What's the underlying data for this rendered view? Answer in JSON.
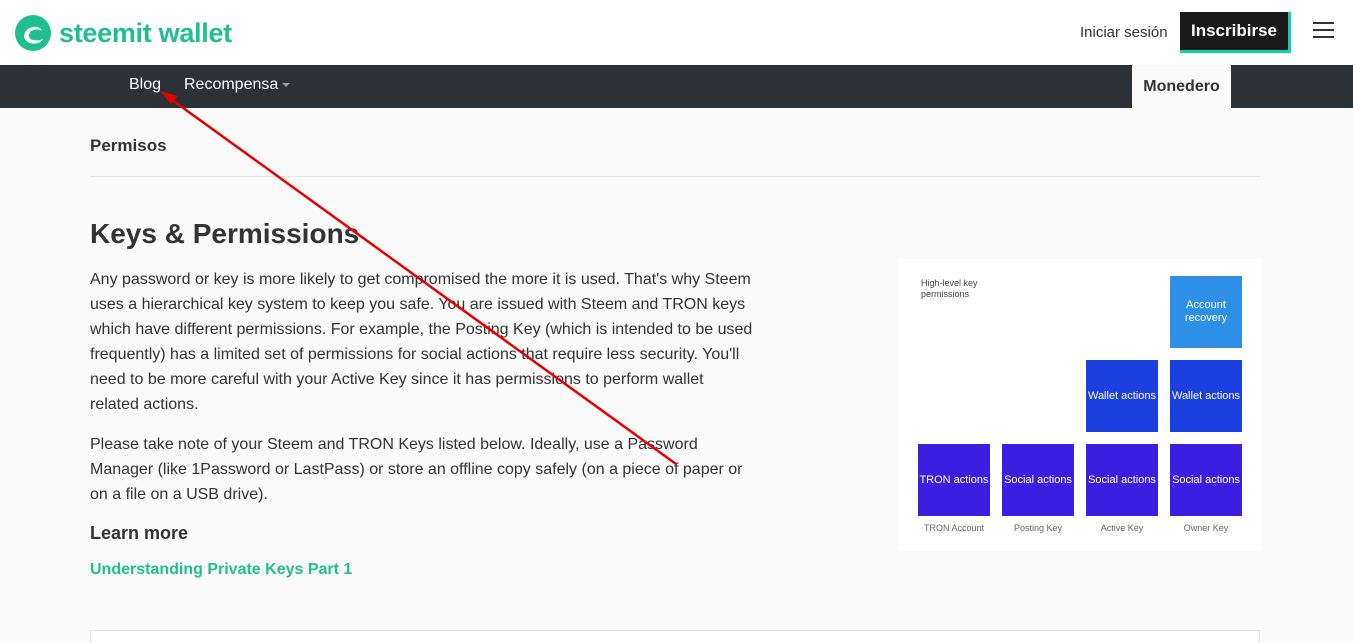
{
  "header": {
    "brand": "steemit wallet",
    "signin_label": "Iniciar sesión",
    "signup_label": "Inscribirse",
    "brand_color": "#1fbf8f"
  },
  "nav": {
    "blog": "Blog",
    "rewards": "Recompensa",
    "wallet": "Monedero"
  },
  "page": {
    "section_title": "Permisos",
    "heading": "Keys & Permissions",
    "paragraph1": "Any password or key is more likely to get compromised the more it is used. That's why Steem uses a hierarchical key system to keep you safe. You are issued with Steem and TRON keys which have different permissions. For example, the Posting Key (which is intended to be used frequently) has a limited set of permissions for social actions that require less security. You'll need to be more careful with your Active Key since it has permissions to perform wallet related actions.",
    "paragraph2": "Please take note of your Steem and TRON Keys listed below. Ideally, use a Password Manager (like 1Password or LastPass) or store an offline copy safely (on a piece of paper or on a file on a USB drive).",
    "learn_more": "Learn more",
    "link": "Understanding Private Keys Part 1"
  },
  "diagram": {
    "title": "High-level key permissions",
    "account_recovery": "Account recovery",
    "wallet_actions": "Wallet actions",
    "tron_actions": "TRON actions",
    "social_actions": "Social actions",
    "labels": [
      "TRON Account",
      "Posting Key",
      "Active Key",
      "Owner Key"
    ],
    "colors": {
      "recovery": "#2e8fe6",
      "wallet": "#1c3fe0",
      "social": "#3b1ee0"
    }
  },
  "annotation": {
    "arrow_color": "#e60000"
  }
}
